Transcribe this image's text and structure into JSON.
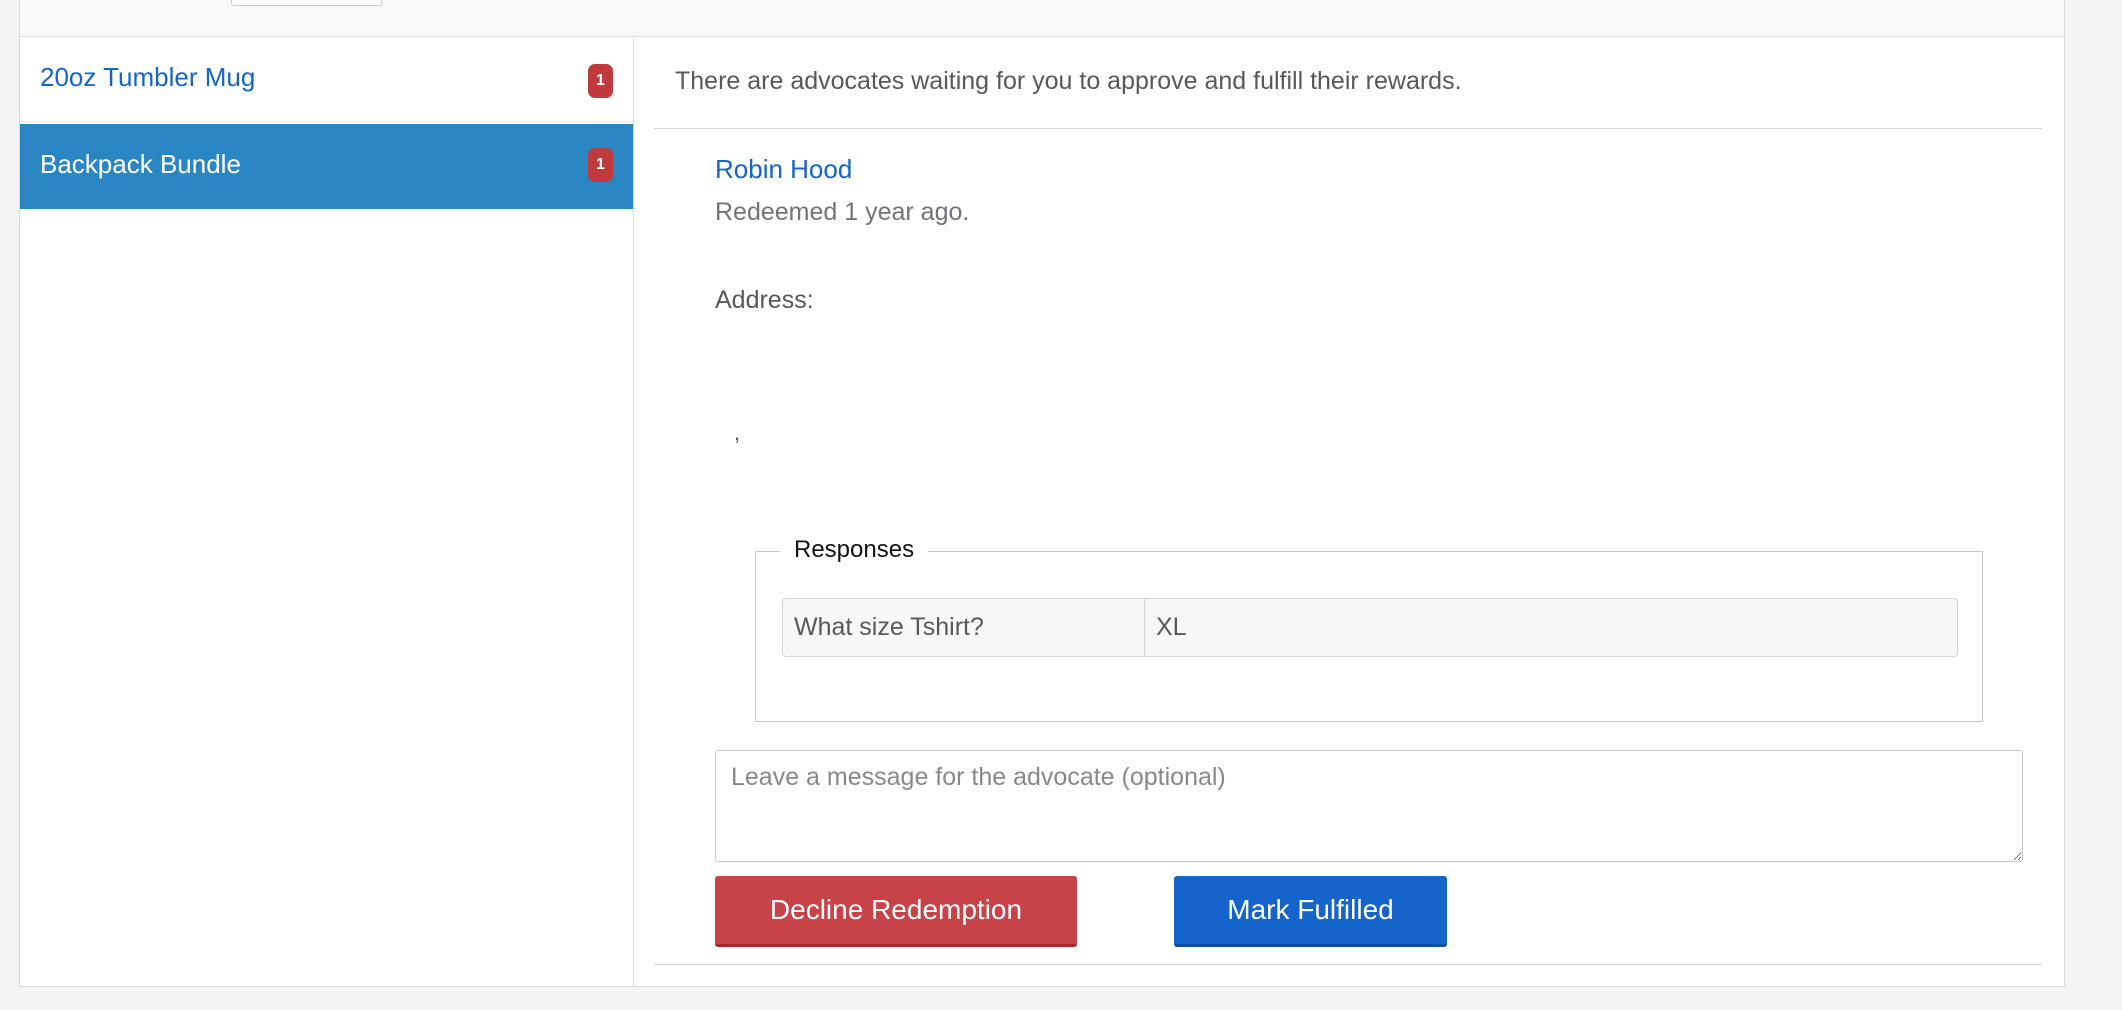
{
  "sidebar": {
    "items": [
      {
        "label": "20oz Tumbler Mug",
        "count": "1"
      },
      {
        "label": "Backpack Bundle",
        "count": "1"
      }
    ]
  },
  "main": {
    "intro": "There are advocates waiting for you to approve and fulfill their rewards.",
    "advocate": {
      "name": "Robin Hood",
      "redeemed": "Redeemed 1 year ago.",
      "address_label": "Address:",
      "address_separator": ","
    },
    "responses": {
      "legend": "Responses",
      "rows": [
        {
          "question": "What size Tshirt?",
          "answer": "XL"
        }
      ]
    },
    "message": {
      "value": "",
      "placeholder": "Leave a message for the advocate (optional)"
    },
    "actions": {
      "decline_label": "Decline Redemption",
      "fulfill_label": "Mark Fulfilled"
    }
  },
  "colors": {
    "accent": "#1565c9",
    "selected_bg": "#2a86c3",
    "badge": "#c0393c",
    "decline": "#c74347",
    "fulfill": "#1464cc"
  }
}
